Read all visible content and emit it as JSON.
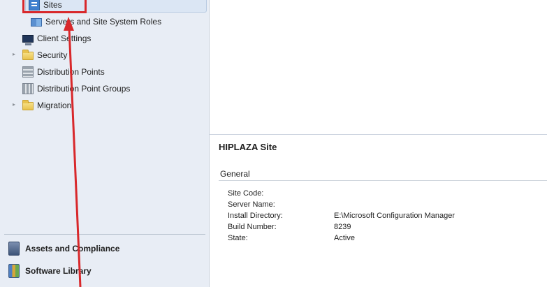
{
  "navigation": {
    "tree": [
      {
        "label": "Sites",
        "icon": "sites-icon",
        "selected": true
      },
      {
        "label": "Servers and Site System Roles",
        "icon": "servers-icon"
      },
      {
        "label": "Client Settings",
        "icon": "client-settings-icon"
      },
      {
        "label": "Security",
        "icon": "folder-icon",
        "expandable": true
      },
      {
        "label": "Distribution Points",
        "icon": "distribution-points-icon"
      },
      {
        "label": "Distribution Point Groups",
        "icon": "distribution-point-groups-icon"
      },
      {
        "label": "Migration",
        "icon": "folder-icon",
        "expandable": true
      }
    ],
    "workspaces": [
      {
        "label": "Assets and Compliance",
        "icon": "assets-compliance-icon"
      },
      {
        "label": "Software Library",
        "icon": "software-library-icon"
      }
    ]
  },
  "details": {
    "title": "HIPLAZA Site",
    "section": "General",
    "properties": [
      {
        "name": "Site Code:",
        "value": ""
      },
      {
        "name": "Server Name:",
        "value": ""
      },
      {
        "name": "Install Directory:",
        "value": "E:\\Microsoft Configuration Manager"
      },
      {
        "name": "Build Number:",
        "value": "8239"
      },
      {
        "name": "State:",
        "value": "Active"
      }
    ]
  },
  "annotation": {
    "highlight_color": "#d8282b",
    "target": "Sites"
  }
}
